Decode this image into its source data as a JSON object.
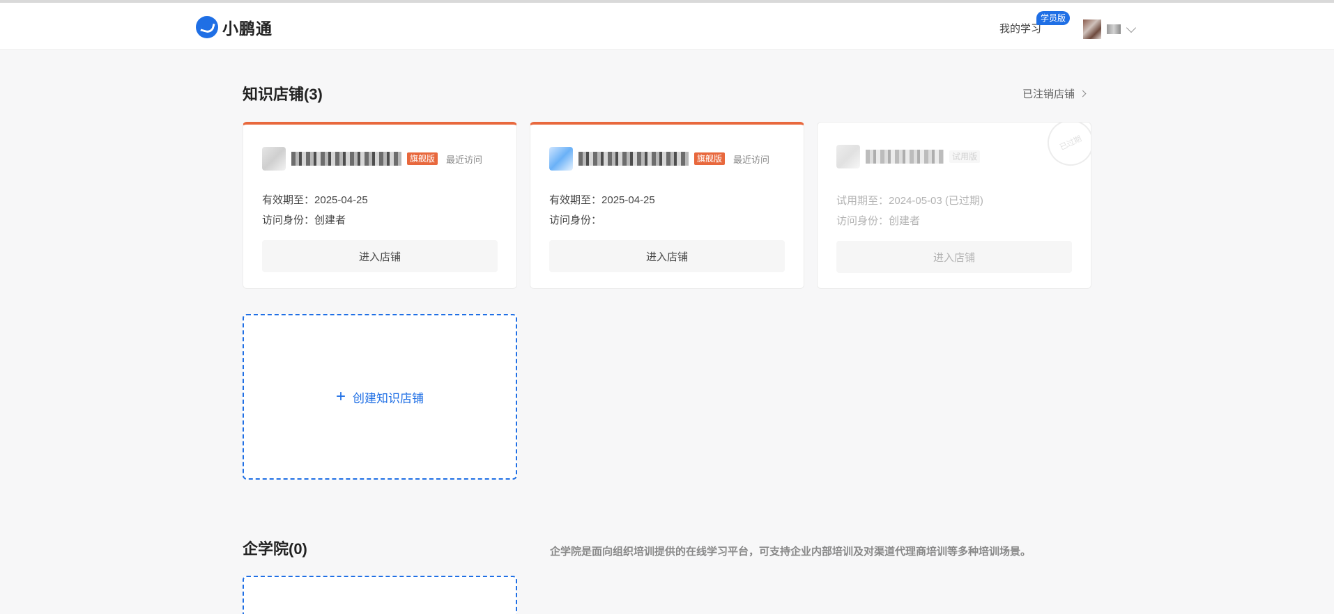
{
  "header": {
    "brand": "小鹏通",
    "my_study": "我的学习",
    "student_badge": "学员版"
  },
  "stores_section": {
    "title": "知识店铺(3)",
    "closed_link": "已注销店铺",
    "cards": [
      {
        "tag": "旗舰版",
        "recent": "最近访问",
        "expiry_label": "有效期至：",
        "expiry_value": "2025-04-25",
        "role_label": "访问身份：",
        "role_value": "创建者",
        "enter": "进入店铺"
      },
      {
        "tag": "旗舰版",
        "recent": "最近访问",
        "expiry_label": "有效期至：",
        "expiry_value": "2025-04-25",
        "role_label": "访问身份：",
        "role_value": "",
        "enter": "进入店铺"
      },
      {
        "tag": "试用版",
        "expiry_label": "试用期至：",
        "expiry_value": "2024-05-03 (已过期)",
        "role_label": "访问身份：",
        "role_value": "创建者",
        "enter": "进入店铺",
        "stamp": "已过期"
      }
    ],
    "create_label": "创建知识店铺"
  },
  "academy_section": {
    "title": "企学院(0)",
    "description": "企学院是面向组织培训提供的在线学习平台，可支持企业内部培训及对渠道代理商培训等多种培训场景。"
  },
  "colors": {
    "brand_blue": "#1f6fe5",
    "flagship_orange": "#e8683d"
  }
}
